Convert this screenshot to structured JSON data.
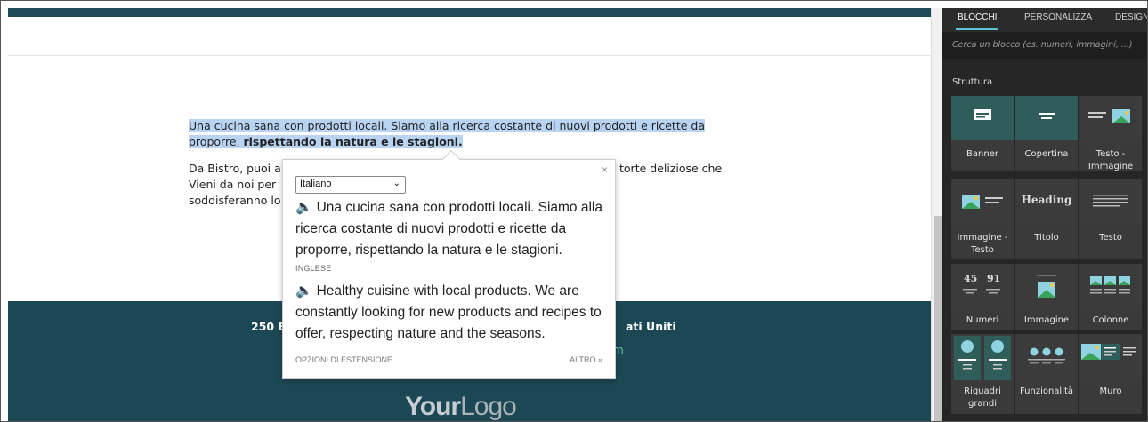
{
  "page": {
    "paragraph1": "Una cucina sana con prodotti locali. Siamo alla ricerca costante di nuovi prodotti e ricette da proporre, ",
    "paragraph1_bold": "rispettando la natura e le stagioni.",
    "paragraph2_line1_start": "Da Bistro, puoi a",
    "paragraph2_line1_end": "torte deliziose che",
    "paragraph2_line2_start": "Vieni da noi per",
    "paragraph2_line3_start": "soddisferanno lo",
    "footer_address_start": "250 E",
    "footer_address_end": "ati Uniti",
    "footer_link_fragment": "m",
    "logo_bold": "Your",
    "logo_light": "Logo"
  },
  "translate_popup": {
    "source_language": "Italiano",
    "source_text": "🔈 Una cucina sana con prodotti locali. Siamo alla ricerca costante di nuovi prodotti e ricette da proporre, rispettando la natura e le stagioni.",
    "target_language_label": "INGLESE",
    "translated_text": "🔈 Healthy cuisine with local products. We are constantly looking for new products and recipes to offer, respecting nature and the seasons.",
    "options_label": "OPZIONI DI ESTENSIONE",
    "more_label": "ALTRO »",
    "close_glyph": "×"
  },
  "panel": {
    "tabs": [
      "BLOCCHI",
      "PERSONALIZZA",
      "DESIGN"
    ],
    "search_placeholder": "Cerca un blocco (es. numeri, immagini, ...)",
    "section_title": "Struttura",
    "blocks": [
      {
        "label": "Banner",
        "icon": "banner-icon"
      },
      {
        "label": "Copertina",
        "icon": "cover-icon"
      },
      {
        "label": "Testo - Immagine",
        "icon": "text-image-icon"
      },
      {
        "label": "Immagine - Testo",
        "icon": "image-text-icon"
      },
      {
        "label": "Titolo",
        "icon": "heading-icon",
        "icon_text": "Heading"
      },
      {
        "label": "Testo",
        "icon": "text-icon"
      },
      {
        "label": "Numeri",
        "icon": "numbers-icon",
        "icon_text_a": "45",
        "icon_text_b": "91"
      },
      {
        "label": "Immagine",
        "icon": "image-icon"
      },
      {
        "label": "Colonne",
        "icon": "columns-icon"
      },
      {
        "label": "Riquadri grandi",
        "icon": "big-boxes-icon"
      },
      {
        "label": "Funzionalità",
        "icon": "features-icon"
      },
      {
        "label": "Muro",
        "icon": "wall-icon"
      }
    ],
    "accent_color": "#5dc2d4",
    "thumb_color": "#2f5d5a"
  }
}
